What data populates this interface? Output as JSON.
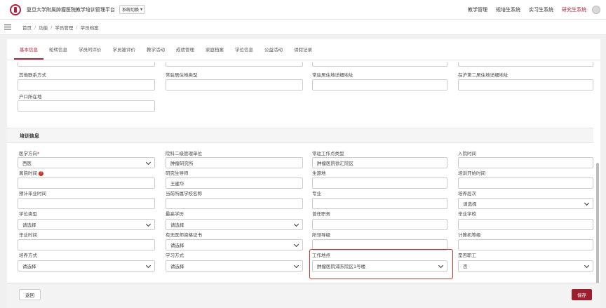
{
  "header": {
    "app_title": "复旦大学附属肿瘤医院教学培训管理平台",
    "system_switch": "系统切换",
    "nav": [
      "教学管理",
      "规培生系统",
      "实习生系统",
      "研究生系统"
    ],
    "accent_color": "#b0223a"
  },
  "breadcrumb": [
    "首页",
    "功能",
    "学员管理",
    "学员档案"
  ],
  "tabs": [
    "基本信息",
    "轮转信息",
    "学员的评价",
    "学员被评价",
    "教学活动",
    "成绩管理",
    "家庭档案",
    "学位信息",
    "公益活动",
    "请假记录"
  ],
  "partial_fields": {
    "other_contact": "其他联系方式",
    "residence_type": "常驻居住地类型",
    "residence_address": "常驻居住地详细地址",
    "shanghai_second_address": "在沪第二居住地详细地址",
    "hukou": "户口所在地"
  },
  "training": {
    "section_title": "培训信息",
    "major_direction_label": "医学方向",
    "major_direction_value": "西医",
    "second_level_unit_label": "院科二级管理单位",
    "second_level_unit_value": "肿瘤研究所",
    "work_location_type_label": "常驻工作点类型",
    "work_location_type_value": "肿瘤医院徐汇院区",
    "admission_time_label": "入院时间",
    "admission_date_label": "离院时间",
    "supervisor_label": "研究生导师",
    "supervisor_value": "王建华",
    "source_label": "生源地",
    "training_start_label": "培训开始时间",
    "expected_graduation_label": "预计毕业时间",
    "current_school_label": "当前所属学校名称",
    "major_label": "专业",
    "training_level_label": "培养层次",
    "training_level_value": "请选择",
    "degree_type_label": "学位类型",
    "degree_type_value": "请选择",
    "highest_education_label": "最高学历",
    "highest_education_value": "请选择",
    "position_label": "曾任职务",
    "graduate_school_label": "毕业学校",
    "graduation_time_label": "毕业时间",
    "physician_cert_label": "有无医师资格证书",
    "physician_cert_value": "请选择",
    "first_level_label": "所领导级",
    "computer_level_label": "计算机等级",
    "training_mode_label": "培养方式",
    "training_mode_value": "请选择",
    "study_mode_label": "学习方式",
    "study_mode_value": "请选择",
    "work_location_label": "工作地点",
    "work_location_value": "肿瘤医院浦东院区1号楼",
    "staff_label": "是否职工",
    "staff_value": "否"
  },
  "footer": {
    "back_label": "返回",
    "save_label": "保存"
  }
}
